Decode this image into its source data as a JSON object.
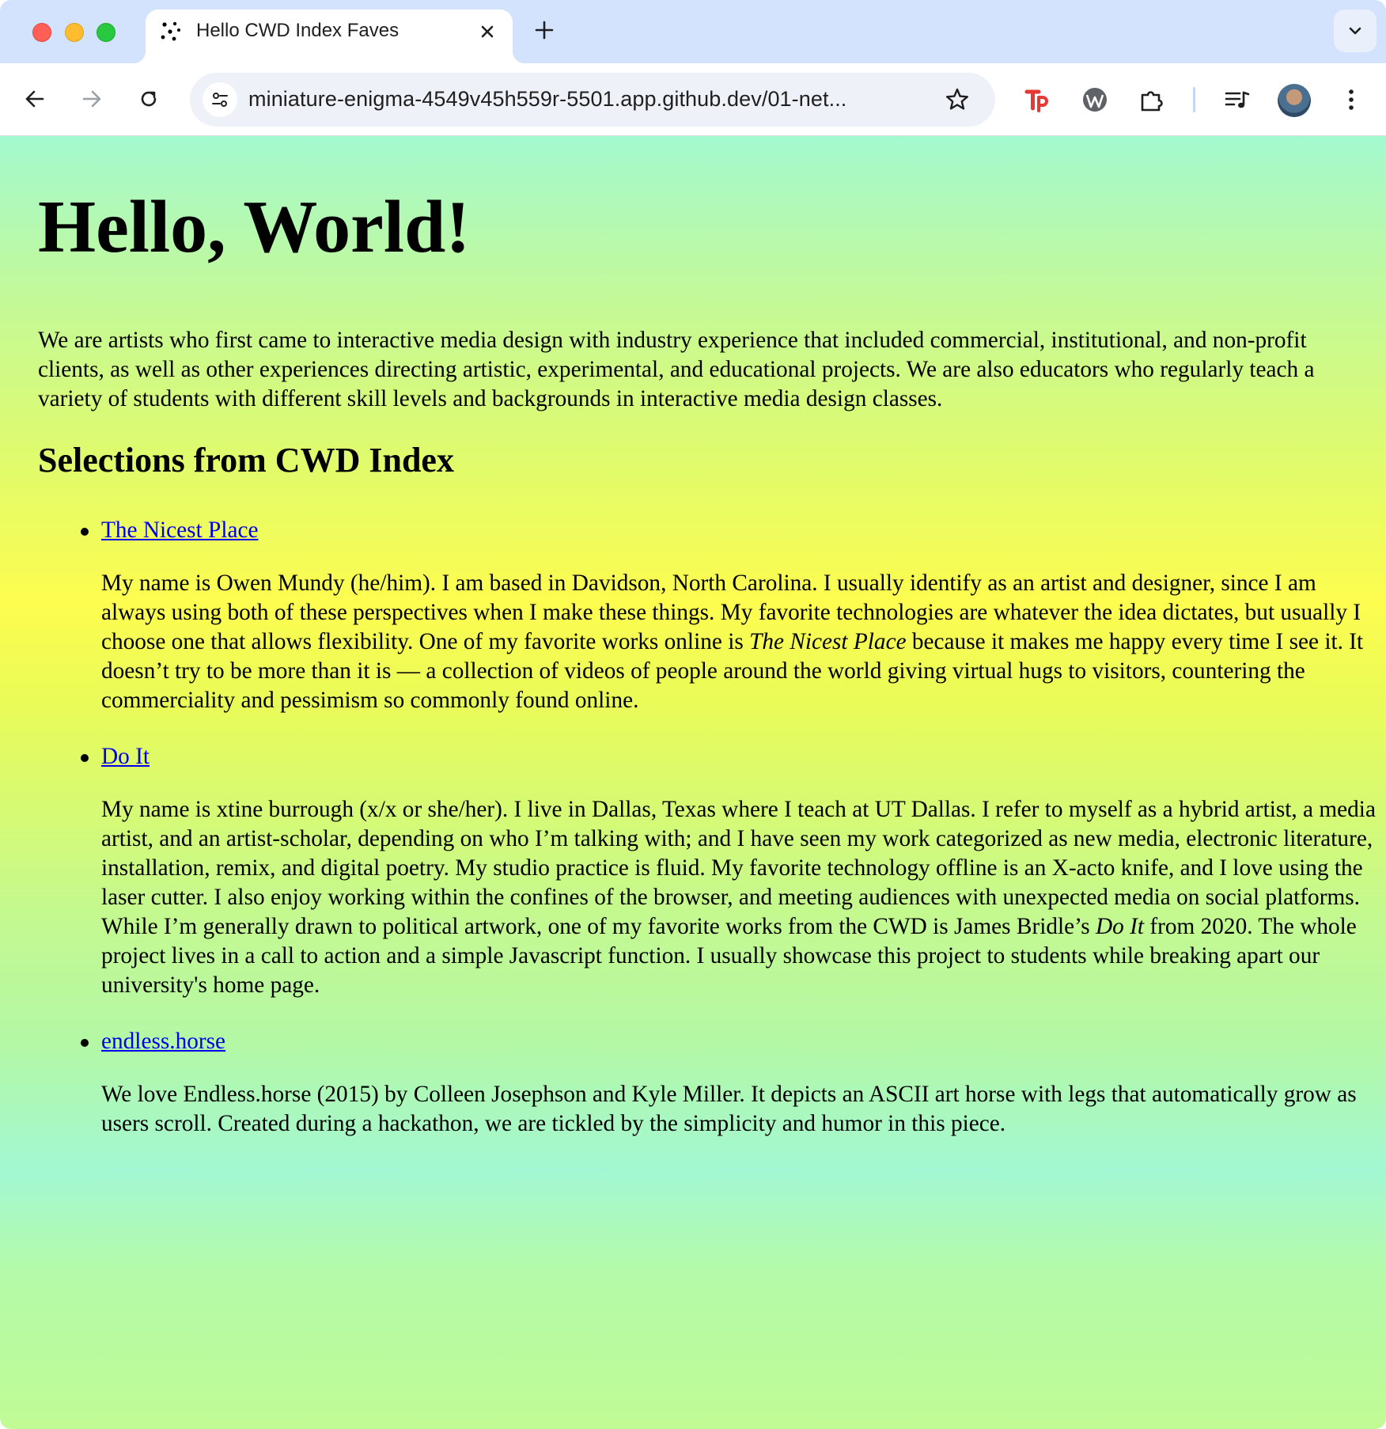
{
  "browser": {
    "tab_title": "Hello CWD Index Faves",
    "url": "miniature-enigma-4549v45h559r-5501.app.github.dev/01-net..."
  },
  "page": {
    "heading": "Hello, World!",
    "intro": "We are artists who first came to interactive media design with industry experience that included commercial, institutional, and non-profit clients, as well as other experiences directing artistic, experimental, and educational projects. We are also educators who regularly teach a variety of students with different skill levels and backgrounds in interactive media design classes.",
    "subheading": "Selections from CWD Index",
    "items": [
      {
        "link": "The Nicest Place",
        "text_before": "My name is Owen Mundy (he/him). I am based in Davidson, North Carolina. I usually identify as an artist and designer, since I am always using both of these perspectives when I make these things. My favorite technologies are whatever the idea dictates, but usually I choose one that allows flexibility. One of my favorite works online is ",
        "text_em": "The Nicest Place",
        "text_after": " because it makes me happy every time I see it. It doesn’t try to be more than it is — a collection of videos of people around the world giving virtual hugs to visitors, countering the commerciality and pessimism so commonly found online."
      },
      {
        "link": "Do It",
        "text_before": "My name is xtine burrough (x/x or she/her). I live in Dallas, Texas where I teach at UT Dallas. I refer to myself as a hybrid artist, a media artist, and an artist-scholar, depending on who I’m talking with; and I have seen my work categorized as new media, electronic literature, installation, remix, and digital poetry. My studio practice is fluid. My favorite technology offline is an X-acto knife, and I love using the laser cutter. I also enjoy working within the confines of the browser, and meeting audiences with unexpected media on social platforms. While I’m generally drawn to political artwork, one of my favorite works from the CWD is James Bridle’s ",
        "text_em": "Do It",
        "text_after": " from 2020. The whole project lives in a call to action and a simple Javascript function. I usually showcase this project to students while breaking apart our university's home page."
      },
      {
        "link": "endless.horse",
        "text_before": "We love Endless.horse (2015) by Colleen Josephson and Kyle Miller. It depicts an ASCII art horse with legs that automatically grow as users scroll. Created during a hackathon, we are tickled by the simplicity and humor in this piece.",
        "text_em": "",
        "text_after": ""
      }
    ]
  },
  "icons": {
    "tab_favicon": "dots-favicon-icon",
    "close": "close-icon",
    "new_tab": "plus-icon",
    "tab_search": "chevron-down-icon",
    "back": "arrow-left-icon",
    "forward": "arrow-right-icon",
    "reload": "reload-icon",
    "site_info": "tune-icon",
    "bookmark": "star-icon",
    "ext1": "tp-extension-icon",
    "ext2": "wordpress-icon",
    "ext3": "puzzle-icon",
    "media": "media-queue-icon",
    "menu": "kebab-menu-icon"
  },
  "colors": {
    "link": "#0000ee",
    "tabstrip": "#d3e3fd",
    "tp_red": "#e53935"
  }
}
